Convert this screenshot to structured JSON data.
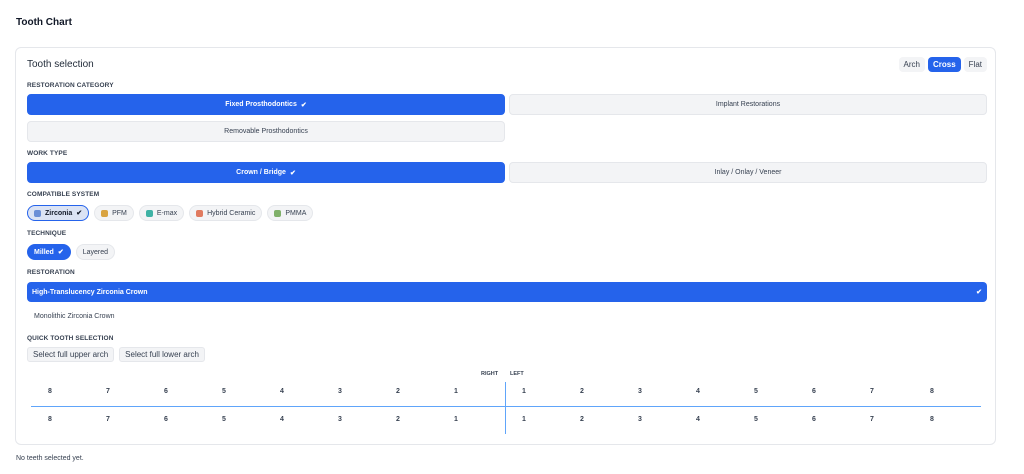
{
  "page_title": "Tooth Chart",
  "card_title": "Tooth selection",
  "view_toggle": {
    "arch": "Arch",
    "cross": "Cross",
    "flat": "Flat",
    "active": "Cross"
  },
  "sections": {
    "restoration_category": "RESTORATION CATEGORY",
    "work_type": "WORK TYPE",
    "compatible_system": "COMPATIBLE SYSTEM",
    "technique": "TECHNIQUE",
    "restoration": "RESTORATION",
    "quick_tooth_selection": "QUICK TOOTH SELECTION"
  },
  "restoration_category": {
    "fixed": "Fixed Prosthodontics",
    "implant": "Implant Restorations",
    "removable": "Removable Prosthodontics",
    "selected": "Fixed Prosthodontics"
  },
  "work_type": {
    "crown": "Crown / Bridge",
    "inlay": "Inlay / Onlay / Veneer",
    "selected": "Crown / Bridge"
  },
  "compatible_system": [
    {
      "label": "Zirconia",
      "color": "#6b8fd6",
      "selected": true
    },
    {
      "label": "PFM",
      "color": "#d9a441",
      "selected": false
    },
    {
      "label": "E-max",
      "color": "#3fb2a5",
      "selected": false
    },
    {
      "label": "Hybrid Ceramic",
      "color": "#e07a5f",
      "selected": false
    },
    {
      "label": "PMMA",
      "color": "#7fb069",
      "selected": false
    }
  ],
  "technique": {
    "milled": "Milled",
    "layered": "Layered",
    "selected": "Milled"
  },
  "restoration": {
    "selected": "High-Translucency Zirconia Crown",
    "other": "Monolithic Zirconia Crown"
  },
  "quick": {
    "upper": "Select full upper arch",
    "lower": "Select full lower arch"
  },
  "chart": {
    "right_label": "RIGHT",
    "left_label": "LEFT",
    "upper_right": [
      "8",
      "7",
      "6",
      "5",
      "4",
      "3",
      "2",
      "1"
    ],
    "upper_left": [
      "1",
      "2",
      "3",
      "4",
      "5",
      "6",
      "7",
      "8"
    ],
    "lower_right": [
      "8",
      "7",
      "6",
      "5",
      "4",
      "3",
      "2",
      "1"
    ],
    "lower_left": [
      "1",
      "2",
      "3",
      "4",
      "5",
      "6",
      "7",
      "8"
    ]
  },
  "footer_note": "No teeth selected yet.",
  "colors": {
    "accent": "#2563eb",
    "divider": "#60a5fa"
  }
}
